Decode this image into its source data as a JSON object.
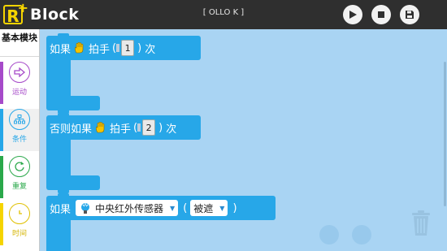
{
  "app": {
    "logo_text": "Block",
    "logo_letter": "R",
    "logo_plus": "+",
    "title": "[ OLLO K ]"
  },
  "toolbar": {
    "play_icon": "play-icon",
    "stop_icon": "stop-icon",
    "save_icon": "save-icon"
  },
  "sidebar": {
    "header": "基本模块",
    "categories": [
      {
        "label": "运动",
        "icon": "arrow-right-icon",
        "color": "#a64ac9"
      },
      {
        "label": "条件",
        "icon": "hierarchy-icon",
        "color": "#27a7e8"
      },
      {
        "label": "重复",
        "icon": "repeat-icon",
        "color": "#2aa84a"
      },
      {
        "label": "时间",
        "icon": "clock-icon",
        "color": "#f5d400"
      }
    ]
  },
  "blocks": [
    {
      "prefix": "如果",
      "icon": "hand-icon",
      "action": "拍手",
      "open": "(",
      "value": "1",
      "close": ")",
      "suffix": "次"
    },
    {
      "prefix": "否则如果",
      "icon": "hand-icon",
      "action": "拍手",
      "open": "(",
      "value": "2",
      "close": ")",
      "suffix": "次"
    },
    {
      "prefix": "如果",
      "icon": "ir-sensor-icon",
      "sensor": "中央红外传感器",
      "open": "(",
      "condition": "被遮",
      "close": ")"
    }
  ],
  "colors": {
    "block": "#27a7e8",
    "canvas": "#a9d4f3",
    "topbar": "#2f2f2f"
  }
}
